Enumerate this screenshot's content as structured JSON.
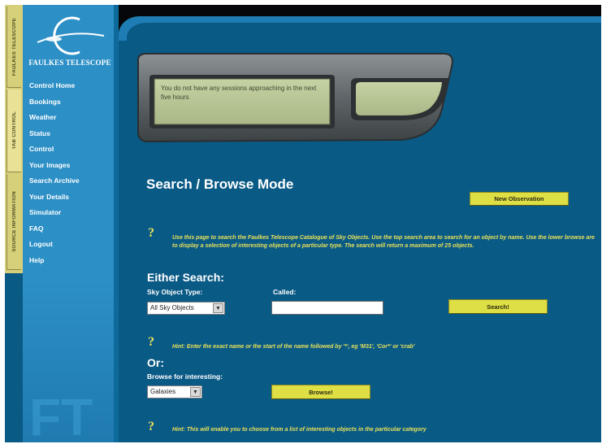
{
  "sidebar": {
    "tabs": [
      "FAULKES TELESCOPE",
      "TAB CONTROL",
      "SOURCE INFORMATION"
    ],
    "brand": "FAULKES TELESCOPE",
    "items": [
      {
        "label": "Control Home"
      },
      {
        "label": "Bookings"
      },
      {
        "label": "Weather"
      },
      {
        "label": "Status"
      },
      {
        "label": "Control"
      },
      {
        "label": "Your Images"
      },
      {
        "label": "Search Archive"
      },
      {
        "label": "Your Details"
      },
      {
        "label": "Simulator"
      },
      {
        "label": "FAQ"
      },
      {
        "label": "Logout"
      },
      {
        "label": "Help"
      }
    ]
  },
  "status": {
    "message": "You do not have any sessions approaching in the next five hours"
  },
  "main": {
    "title": "Search / Browse Mode",
    "new_observation_label": "New Observation",
    "intro": "Use this page to search the Faulkes Telescope Catalogue of Sky Objects. Use the top search area to search for an object by name. Use the lower browse are to display a selection of interesting objects of a particular type. The search will return a maximum of 25 objects.",
    "help_mark": "?",
    "either_search": "Either Search:",
    "sky_object_type_label": "Sky Object Type:",
    "sky_object_type_value": "All Sky Objects",
    "called_label": "Called:",
    "called_value": "",
    "search_label": "Search!",
    "search_hint": "Hint: Enter the exact name or the start of the name followed by '*', eg 'M31', 'Cor*' or 'crab'",
    "or_label": "Or:",
    "browse_label": "Browse for interesting:",
    "browse_value": "Galaxies",
    "browse_button_label": "Browse!",
    "browse_hint": "Hint: This will enable you to choose from a list of interesting objects in the particular category"
  },
  "colors": {
    "background": "#0a5a86",
    "sidebar": "#2c8fc6",
    "accent_yellow": "#dede45",
    "hint_text": "#e6e05a"
  }
}
